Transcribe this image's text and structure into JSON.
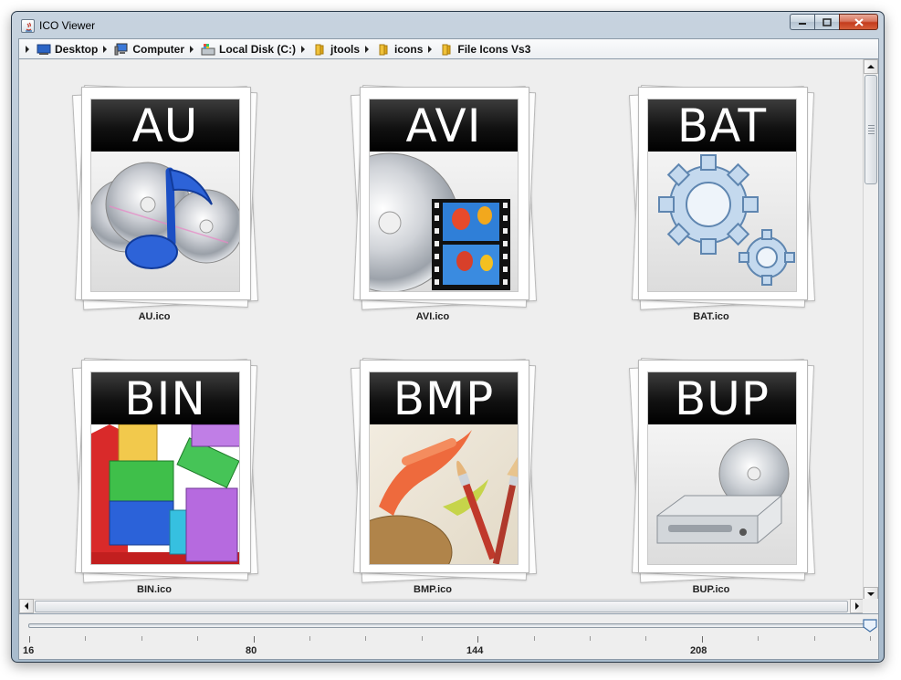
{
  "window": {
    "title": "ICO Viewer"
  },
  "breadcrumb": [
    {
      "label": "Desktop",
      "icon": "desktop-icon"
    },
    {
      "label": "Computer",
      "icon": "computer-icon"
    },
    {
      "label": "Local Disk (C:)",
      "icon": "disk-icon"
    },
    {
      "label": "jtools",
      "icon": "folder-icon"
    },
    {
      "label": "icons",
      "icon": "folder-icon"
    },
    {
      "label": "File Icons Vs3",
      "icon": "folder-icon"
    }
  ],
  "files": [
    {
      "banner": "AU",
      "name": "AU.ico",
      "icon": "music-cd-icon"
    },
    {
      "banner": "AVI",
      "name": "AVI.ico",
      "icon": "video-cd-icon"
    },
    {
      "banner": "BAT",
      "name": "BAT.ico",
      "icon": "gears-icon"
    },
    {
      "banner": "BIN",
      "name": "BIN.ico",
      "icon": "bar-blocks-icon"
    },
    {
      "banner": "BMP",
      "name": "BMP.ico",
      "icon": "paint-brushes-icon"
    },
    {
      "banner": "BUP",
      "name": "BUP.ico",
      "icon": "disc-drive-icon"
    }
  ],
  "zoom_slider": {
    "min": 16,
    "max": 256,
    "value": 256,
    "tick_labels": [
      "16",
      "80",
      "144",
      "208"
    ]
  },
  "colors": {
    "banner": "#000000",
    "content_bg": "#eeeeee",
    "frame": "#b4c4d4"
  }
}
